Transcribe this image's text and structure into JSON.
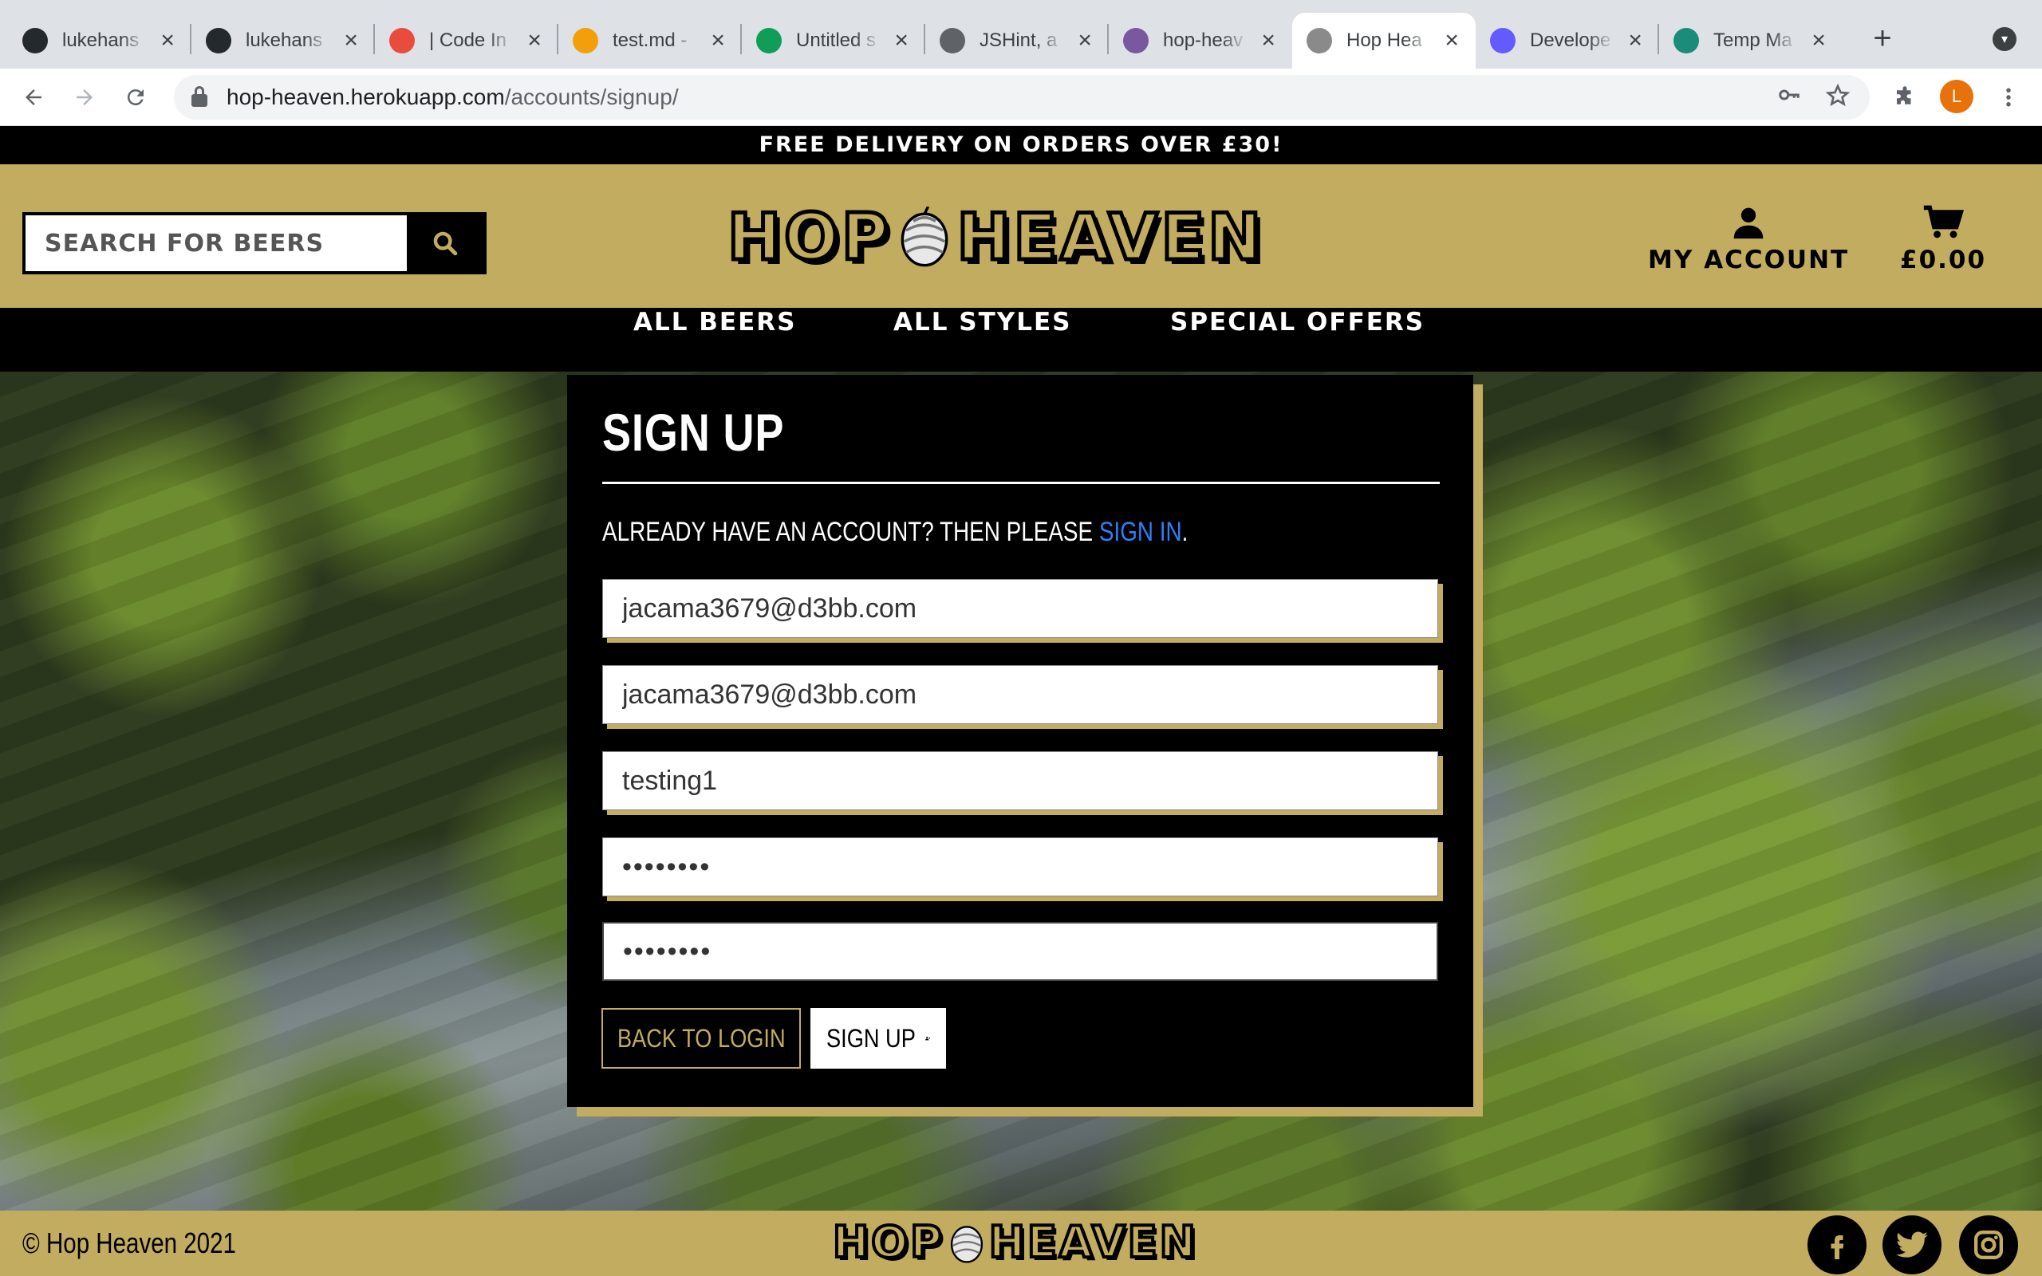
{
  "browser": {
    "tabs": [
      {
        "title": "lukehans",
        "icon": "github-icon",
        "color": "#24292e"
      },
      {
        "title": "lukehans",
        "icon": "github-icon",
        "color": "#24292e"
      },
      {
        "title": "| Code In",
        "icon": "codeinstitute-icon",
        "color": "#e84c3d"
      },
      {
        "title": "test.md -",
        "icon": "gitpod-icon",
        "color": "#f59e0b"
      },
      {
        "title": "Untitled s",
        "icon": "sheets-icon",
        "color": "#0f9d58"
      },
      {
        "title": "JSHint, a",
        "icon": "globe-icon",
        "color": "#5f6368"
      },
      {
        "title": "hop-heav",
        "icon": "heroku-icon",
        "color": "#79589f"
      },
      {
        "title": "Hop Hea",
        "icon": "hop-icon",
        "color": "#8a8a8a"
      },
      {
        "title": "Develope",
        "icon": "stripe-icon",
        "color": "#635bff"
      },
      {
        "title": "Temp Ma",
        "icon": "tempmail-icon",
        "color": "#1b8b7a"
      }
    ],
    "active_tab": 7,
    "url_host": "hop-heaven.herokuapp.com",
    "url_path": "/accounts/signup/",
    "profile_initial": "L"
  },
  "site": {
    "banner": "FREE DELIVERY ON ORDERS OVER £30!",
    "search_placeholder": "SEARCH FOR BEERS",
    "logo_left": "HOP",
    "logo_right": "HEAVEN",
    "account_label": "MY ACCOUNT",
    "cart_total": "£0.00",
    "nav": [
      "ALL BEERS",
      "ALL STYLES",
      "SPECIAL OFFERS"
    ],
    "accent_color": "#c2ac5f"
  },
  "signup": {
    "title": "SIGN UP",
    "subtitle_prefix": "ALREADY HAVE AN ACCOUNT? THEN PLEASE ",
    "subtitle_link": "SIGN IN",
    "subtitle_suffix": ".",
    "email": "jacama3679@d3bb.com",
    "email_confirm": "jacama3679@d3bb.com",
    "username": "testing1",
    "password": "••••••••",
    "password_confirm": "••••••••",
    "back_label": "BACK TO LOGIN",
    "signup_label": "SIGN UP"
  },
  "footer": {
    "copyright": "© Hop Heaven 2021",
    "logo_left": "HOP",
    "logo_right": "HEAVEN",
    "social": [
      "facebook-icon",
      "twitter-icon",
      "instagram-icon"
    ]
  }
}
